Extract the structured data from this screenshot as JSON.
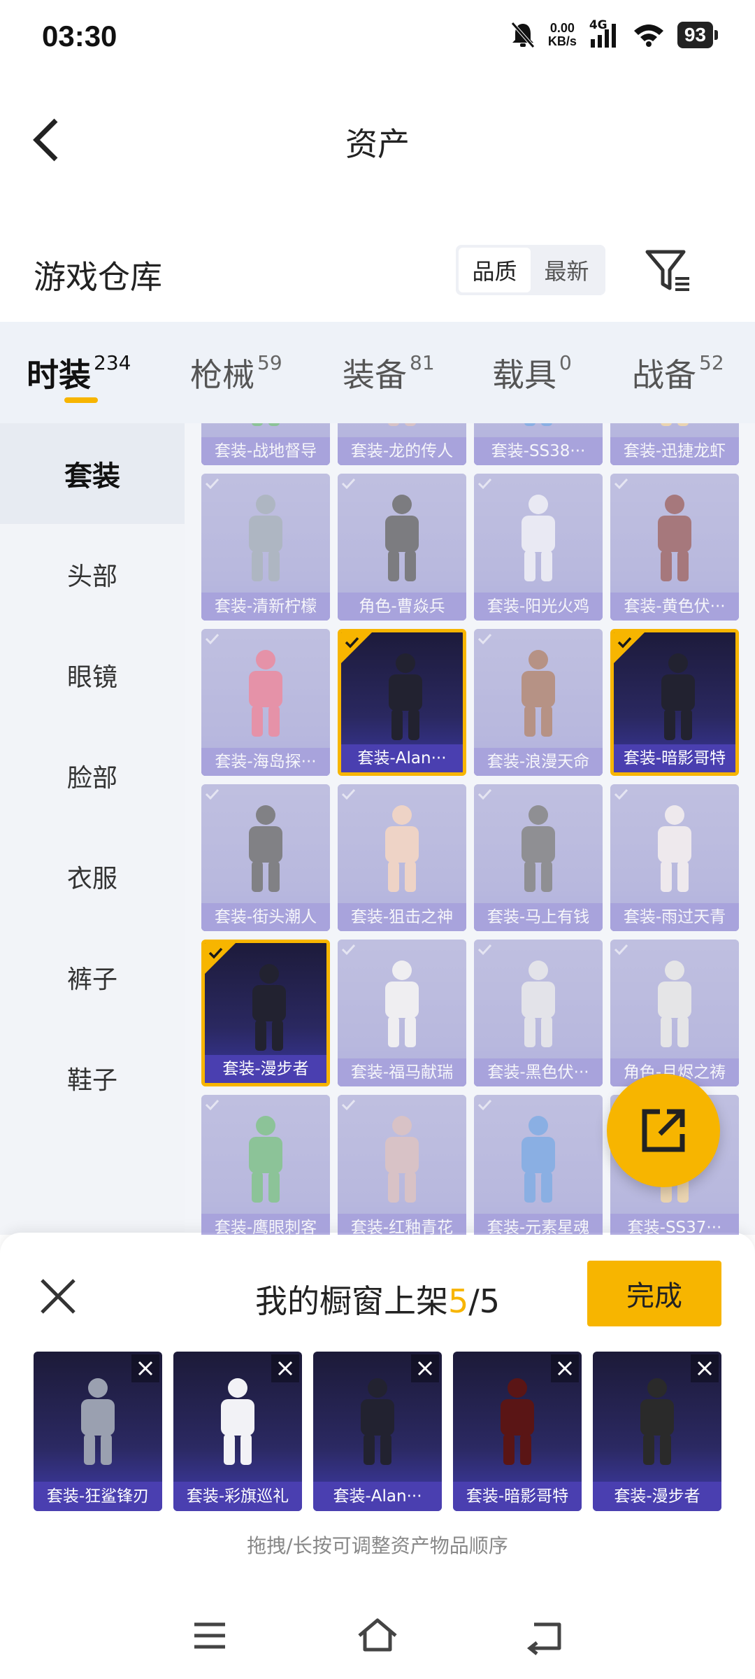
{
  "status_bar": {
    "time": "03:30",
    "speed_value": "0.00",
    "speed_unit": "KB/s",
    "network": "4G",
    "battery": "93"
  },
  "header": {
    "title": "资产"
  },
  "warehouse": {
    "title": "游戏仓库",
    "sort_options": [
      "品质",
      "最新"
    ],
    "sort_selected": "品质"
  },
  "tabs": [
    {
      "label": "时装",
      "count": "234",
      "active": true
    },
    {
      "label": "枪械",
      "count": "59",
      "active": false
    },
    {
      "label": "装备",
      "count": "81",
      "active": false
    },
    {
      "label": "载具",
      "count": "0",
      "active": false
    },
    {
      "label": "战备",
      "count": "52",
      "active": false
    }
  ],
  "sidebar": [
    {
      "label": "套装",
      "active": true
    },
    {
      "label": "头部",
      "active": false
    },
    {
      "label": "眼镜",
      "active": false
    },
    {
      "label": "脸部",
      "active": false
    },
    {
      "label": "衣服",
      "active": false
    },
    {
      "label": "裤子",
      "active": false
    },
    {
      "label": "鞋子",
      "active": false
    }
  ],
  "items": [
    {
      "label": "套装-战地督导",
      "selected": false
    },
    {
      "label": "套装-龙的传人",
      "selected": false
    },
    {
      "label": "套装-SS38···",
      "selected": false
    },
    {
      "label": "套装-迅捷龙虾",
      "selected": false
    },
    {
      "label": "套装-清新柠檬",
      "selected": false
    },
    {
      "label": "角色-曹焱兵",
      "selected": false
    },
    {
      "label": "套装-阳光火鸡",
      "selected": false
    },
    {
      "label": "套装-黄色伏···",
      "selected": false
    },
    {
      "label": "套装-海岛探···",
      "selected": false
    },
    {
      "label": "套装-Alan···",
      "selected": true
    },
    {
      "label": "套装-浪漫天命",
      "selected": false
    },
    {
      "label": "套装-暗影哥特",
      "selected": true
    },
    {
      "label": "套装-街头潮人",
      "selected": false
    },
    {
      "label": "套装-狙击之神",
      "selected": false
    },
    {
      "label": "套装-马上有钱",
      "selected": false
    },
    {
      "label": "套装-雨过天青",
      "selected": false
    },
    {
      "label": "套装-漫步者",
      "selected": true
    },
    {
      "label": "套装-福马献瑞",
      "selected": false
    },
    {
      "label": "套装-黑色伏···",
      "selected": false
    },
    {
      "label": "角色-月烬之祷",
      "selected": false
    },
    {
      "label": "套装-鹰眼刺客",
      "selected": false
    },
    {
      "label": "套装-红釉青花",
      "selected": false
    },
    {
      "label": "套装-元素星魂",
      "selected": false
    },
    {
      "label": "套装-SS37···",
      "selected": false
    }
  ],
  "sheet": {
    "title_prefix": "我的橱窗上架",
    "count_current": "5",
    "count_total": "/5",
    "done_label": "完成",
    "hint": "拖拽/长按可调整资产物品顺序",
    "showcase": [
      {
        "label": "套装-狂鲨锋刃"
      },
      {
        "label": "套装-彩旗巡礼"
      },
      {
        "label": "套装-Alan···"
      },
      {
        "label": "套装-暗影哥特"
      },
      {
        "label": "套装-漫步者"
      }
    ]
  },
  "colors": {
    "accent": "#f7b500",
    "card": "#8f8fcd",
    "selected_card": "#2a2860"
  }
}
